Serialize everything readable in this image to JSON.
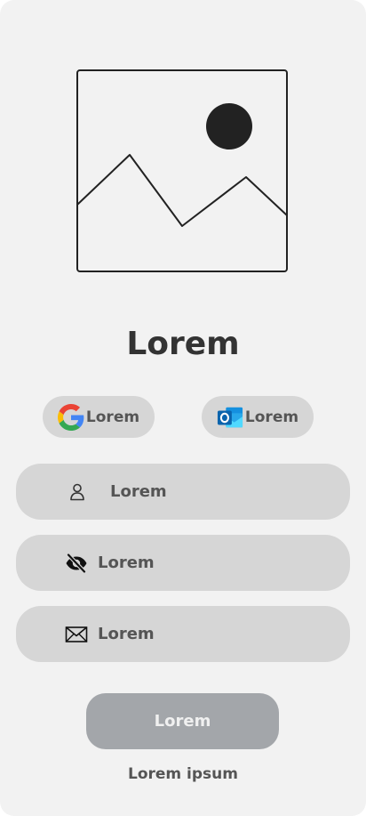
{
  "header": {
    "title": "Lorem"
  },
  "social": {
    "google": {
      "label": "Lorem",
      "icon": "google-icon"
    },
    "outlook": {
      "label": "Lorem",
      "icon": "outlook-icon"
    }
  },
  "form": {
    "username": {
      "placeholder": "Lorem",
      "icon": "user-icon"
    },
    "password": {
      "placeholder": "Lorem",
      "icon": "eye-off-icon"
    },
    "email": {
      "placeholder": "Lorem",
      "icon": "envelope-icon"
    }
  },
  "actions": {
    "submit_label": "Lorem",
    "secondary_link": "Lorem ipsum"
  },
  "colors": {
    "background": "#f2f2f2",
    "pill": "#d6d6d6",
    "button": "#a3a6aa",
    "text": "#555555",
    "title": "#333333"
  }
}
